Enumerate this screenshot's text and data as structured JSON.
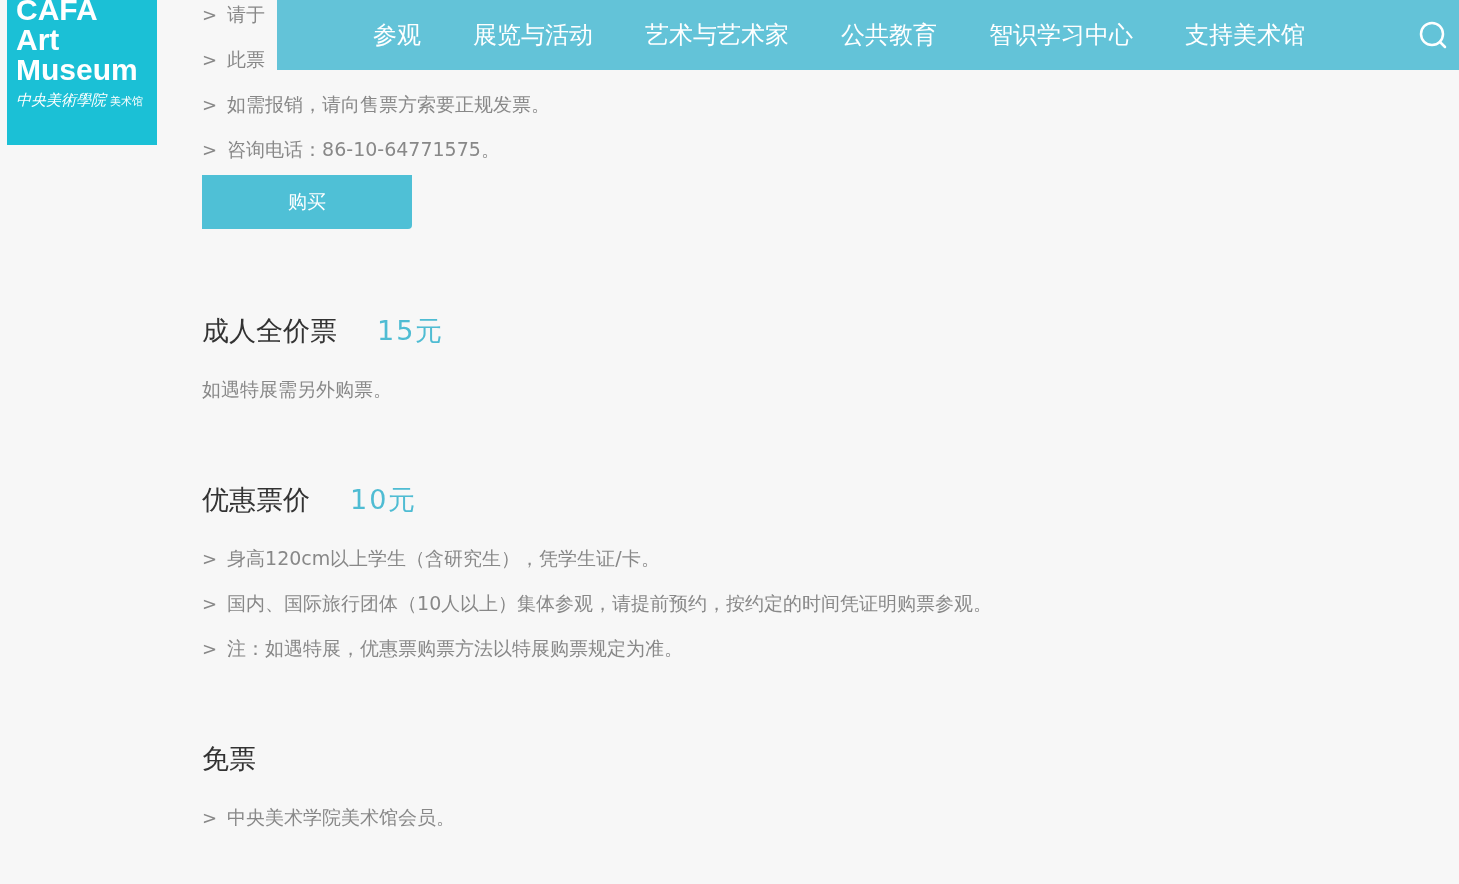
{
  "logo": {
    "lines": [
      "CAFA",
      "Art",
      "Museum"
    ],
    "subtitle": "中央美術學院",
    "subtitle_small": "美术馆"
  },
  "nav": {
    "items": [
      {
        "label": "参观"
      },
      {
        "label": "展览与活动"
      },
      {
        "label": "艺术与艺术家"
      },
      {
        "label": "公共教育"
      },
      {
        "label": "智识学习中心"
      },
      {
        "label": "支持美术馆"
      }
    ]
  },
  "notes": [
    {
      "marker": ">",
      "text": "请于"
    },
    {
      "marker": ">",
      "text": "此票"
    },
    {
      "marker": ">",
      "text": "如需报销，请向售票方索要正规发票。"
    },
    {
      "marker": ">",
      "text": "咨询电话：86-10-64771575。"
    }
  ],
  "buy_button": "购买",
  "tickets": [
    {
      "name": "成人全价票",
      "price": "15元",
      "notes": [
        {
          "text": "如遇特展需另外购票。"
        }
      ]
    },
    {
      "name": "优惠票价",
      "price": "10元",
      "notes": [
        {
          "marker": ">",
          "text": "身高120cm以上学生（含研究生），凭学生证/卡。"
        },
        {
          "marker": ">",
          "text": "国内、国际旅行团体（10人以上）集体参观，请提前预约，按约定的时间凭证明购票参观。"
        },
        {
          "marker": ">",
          "text": "注：如遇特展，优惠票购票方法以特展购票规定为准。"
        }
      ]
    },
    {
      "name": "免票",
      "notes": [
        {
          "marker": ">",
          "text": "中央美术学院美术馆会员。"
        }
      ]
    }
  ]
}
